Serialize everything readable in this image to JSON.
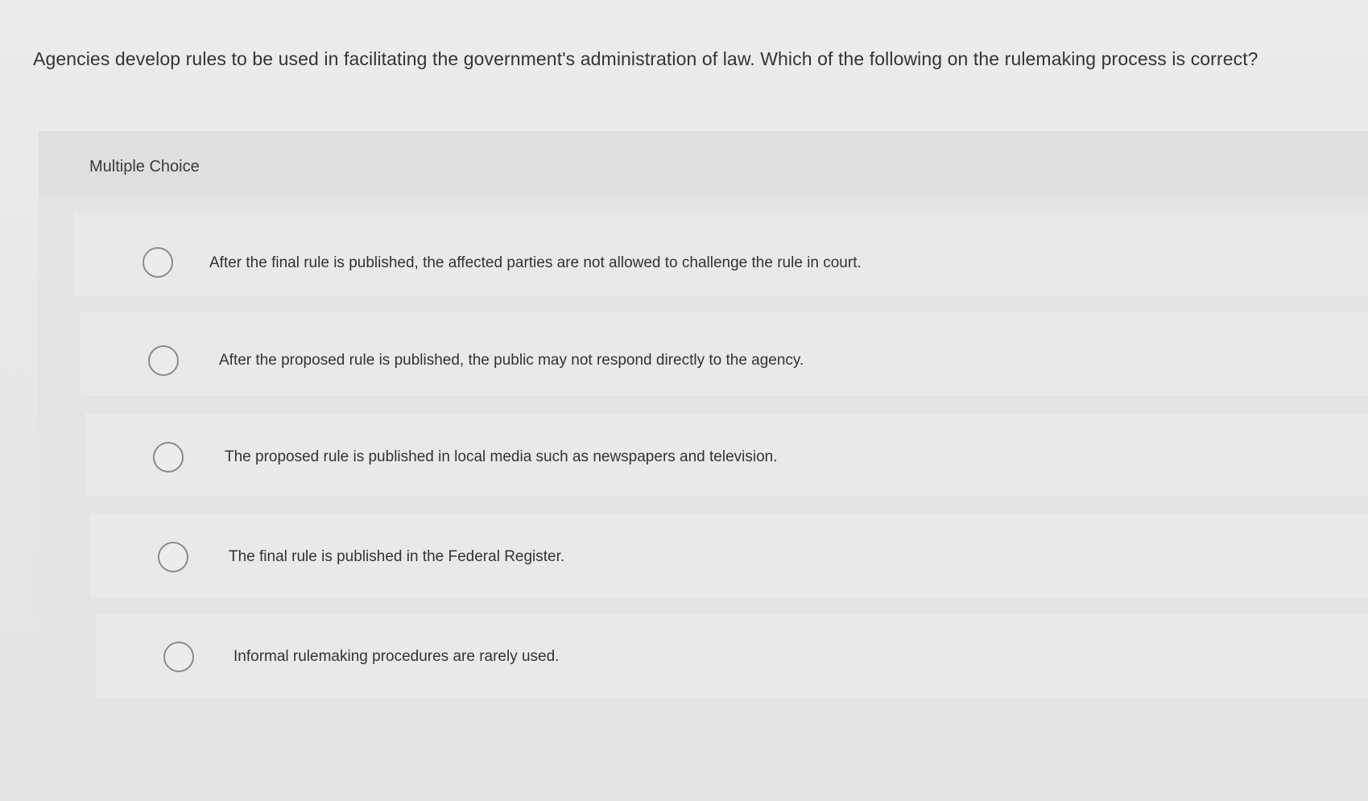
{
  "question": {
    "text": "Agencies develop rules to be used in facilitating the government's administration of law. Which of the following on the rulemaking process is correct?"
  },
  "panel": {
    "type_label": "Multiple Choice"
  },
  "choices": [
    {
      "label": "After the final rule is published, the affected parties are not allowed to challenge the rule in court."
    },
    {
      "label": "After the proposed rule is published, the public may not respond directly to the agency."
    },
    {
      "label": "The proposed rule is published in local media such as newspapers and television."
    },
    {
      "label": "The final rule is published in the Federal Register."
    },
    {
      "label": "Informal rulemaking procedures are rarely used."
    }
  ]
}
